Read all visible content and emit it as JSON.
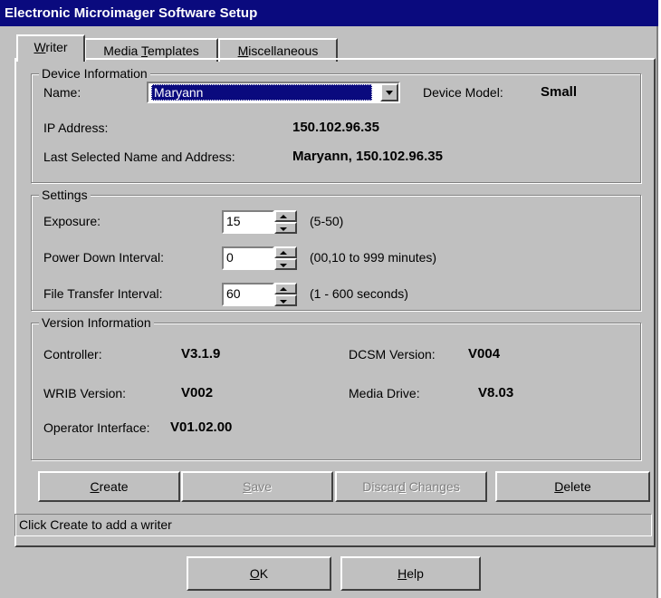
{
  "window": {
    "title": "Electronic Microimager Software Setup"
  },
  "tabs": [
    {
      "pre": "",
      "u": "W",
      "post": "riter"
    },
    {
      "pre": "Media ",
      "u": "T",
      "post": "emplates"
    },
    {
      "pre": "",
      "u": "M",
      "post": "iscellaneous"
    }
  ],
  "device": {
    "legend": "Device Information",
    "name_label": "Name:",
    "name_value": "Maryann",
    "model_label": "Device Model:",
    "model_value": "Small",
    "ip_label": "IP Address:",
    "ip_value": "150.102.96.35",
    "last_label": "Last Selected Name and Address:",
    "last_value": "Maryann, 150.102.96.35"
  },
  "settings": {
    "legend": "Settings",
    "exposure_label": "Exposure:",
    "exposure_value": "15",
    "exposure_range": "(5-50)",
    "power_label": "Power Down Interval:",
    "power_value": "0",
    "power_range": "(00,10 to 999 minutes)",
    "transfer_label": "File Transfer Interval:",
    "transfer_value": "60",
    "transfer_range": "(1 - 600 seconds)"
  },
  "version": {
    "legend": "Version Information",
    "controller_label": "Controller:",
    "controller_value": "V3.1.9",
    "dcsm_label": "DCSM Version:",
    "dcsm_value": "V004",
    "wrib_label": "WRIB Version:",
    "wrib_value": "V002",
    "media_label": "Media Drive:",
    "media_value": "V8.03",
    "operator_label": "Operator Interface:",
    "operator_value": "V01.02.00"
  },
  "buttons": {
    "create": {
      "u": "C",
      "post": "reate"
    },
    "save": {
      "u": "S",
      "post": "ave"
    },
    "discard": {
      "pre": "Discar",
      "u": "d",
      "post": " Changes"
    },
    "delete": {
      "u": "D",
      "post": "elete"
    },
    "ok": {
      "u": "O",
      "post": "K"
    },
    "help": {
      "u": "H",
      "post": "elp"
    }
  },
  "status_text": "Click Create to add a writer",
  "colors": {
    "face": "#c0c0c0",
    "title": "#0a0a7e",
    "highlight": "#0a0a7e"
  }
}
